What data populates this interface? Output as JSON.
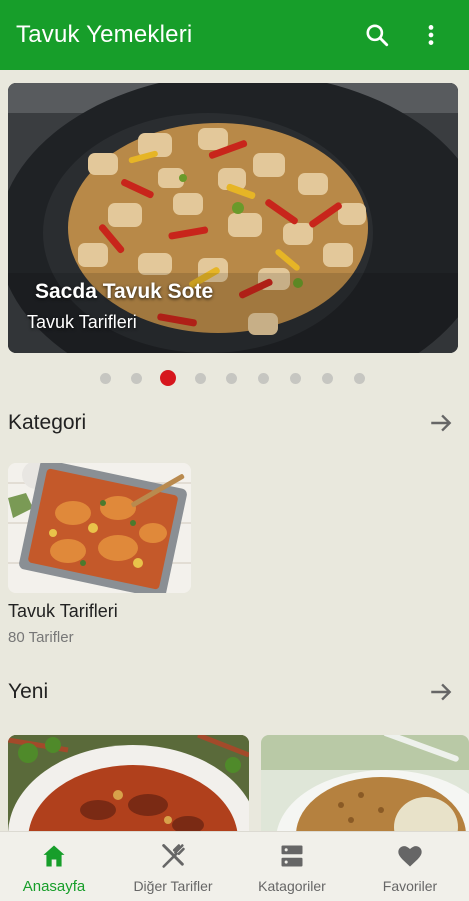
{
  "appbar": {
    "title": "Tavuk Yemekleri",
    "search_icon": "search-icon",
    "more_icon": "more-vert-icon",
    "color": "#179e2a"
  },
  "slider": {
    "title": "Sacda Tavuk Sote",
    "subtitle": "Tavuk Tarifleri",
    "dot_count": 9,
    "active_index": 2,
    "active_color": "#d6161d"
  },
  "categories": {
    "title": "Kategori",
    "items": [
      {
        "name": "Tavuk Tarifleri",
        "count": "80 Tarifler"
      }
    ]
  },
  "new_section": {
    "title": "Yeni"
  },
  "bottom_nav": [
    {
      "label": "Anasayfa",
      "icon": "home-icon",
      "active": true
    },
    {
      "label": "Diğer Tarifler",
      "icon": "fork-knife-icon",
      "active": false
    },
    {
      "label": "Katagoriler",
      "icon": "categories-icon",
      "active": false
    },
    {
      "label": "Favoriler",
      "icon": "heart-icon",
      "active": false
    }
  ]
}
